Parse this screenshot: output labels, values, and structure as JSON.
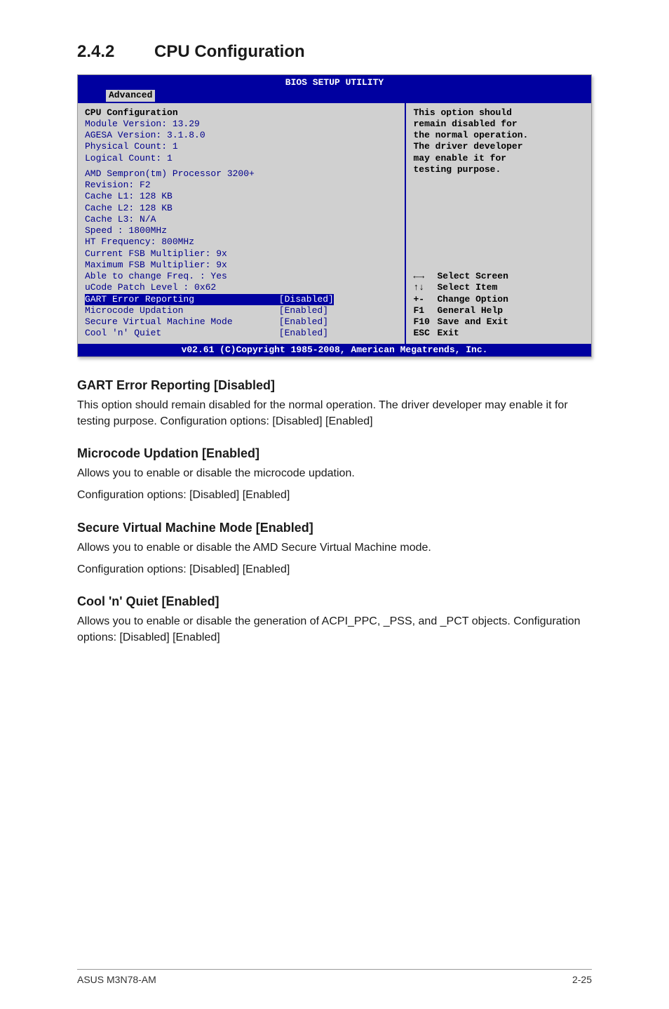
{
  "section": {
    "number": "2.4.2",
    "title": "CPU Configuration"
  },
  "bios": {
    "title": "BIOS SETUP UTILITY",
    "tab": "Advanced",
    "left": {
      "heading": "CPU Configuration",
      "info1": [
        "Module Version: 13.29",
        "AGESA Version: 3.1.8.0",
        "Physical Count: 1",
        "Logical Count: 1"
      ],
      "info2": [
        "AMD Sempron(tm) Processor 3200+",
        "Revision: F2",
        "Cache L1: 128 KB",
        "Cache L2: 128 KB",
        "Cache L3: N/A",
        "Speed   : 1800MHz",
        "HT Frequency: 800MHz",
        "Current FSB Multiplier: 9x",
        "Maximum FSB Multiplier: 9x",
        "Able to change Freq.  : Yes",
        "uCode Patch Level     : 0x62"
      ],
      "settings": [
        {
          "label": "GART Error Reporting",
          "value": "[Disabled]",
          "selected": true
        },
        {
          "label": "Microcode Updation",
          "value": "[Enabled]",
          "selected": false
        },
        {
          "label": "Secure Virtual Machine Mode",
          "value": "[Enabled]",
          "selected": false
        },
        {
          "label": "Cool 'n' Quiet",
          "value": "[Enabled]",
          "selected": false
        }
      ]
    },
    "help": "This option should\nremain disabled for\nthe normal operation.\nThe driver developer\nmay enable it for\ntesting purpose.",
    "keys": [
      {
        "k": "←→",
        "d": "Select Screen"
      },
      {
        "k": "↑↓",
        "d": "Select Item"
      },
      {
        "k": "+-",
        "d": "Change Option"
      },
      {
        "k": "F1",
        "d": "General Help"
      },
      {
        "k": "F10",
        "d": "Save and Exit"
      },
      {
        "k": "ESC",
        "d": "Exit"
      }
    ],
    "footer": "v02.61 (C)Copyright 1985-2008, American Megatrends, Inc."
  },
  "body_sections": [
    {
      "heading": "GART Error Reporting [Disabled]",
      "paras": [
        "This option should remain disabled for the normal operation. The driver developer may enable it for testing purpose. Configuration options: [Disabled] [Enabled]"
      ]
    },
    {
      "heading": "Microcode Updation [Enabled]",
      "paras": [
        "Allows you to enable or disable the microcode updation.",
        "Configuration options: [Disabled] [Enabled]"
      ]
    },
    {
      "heading": "Secure Virtual Machine Mode [Enabled]",
      "paras": [
        "Allows you to enable or disable the AMD Secure Virtual Machine mode.",
        "Configuration options: [Disabled] [Enabled]"
      ]
    },
    {
      "heading": "Cool 'n' Quiet [Enabled]",
      "paras": [
        "Allows you to enable or disable the generation of ACPI_PPC, _PSS, and _PCT objects. Configuration options: [Disabled] [Enabled]"
      ]
    }
  ],
  "footer": {
    "left": "ASUS M3N78-AM",
    "right": "2-25"
  }
}
